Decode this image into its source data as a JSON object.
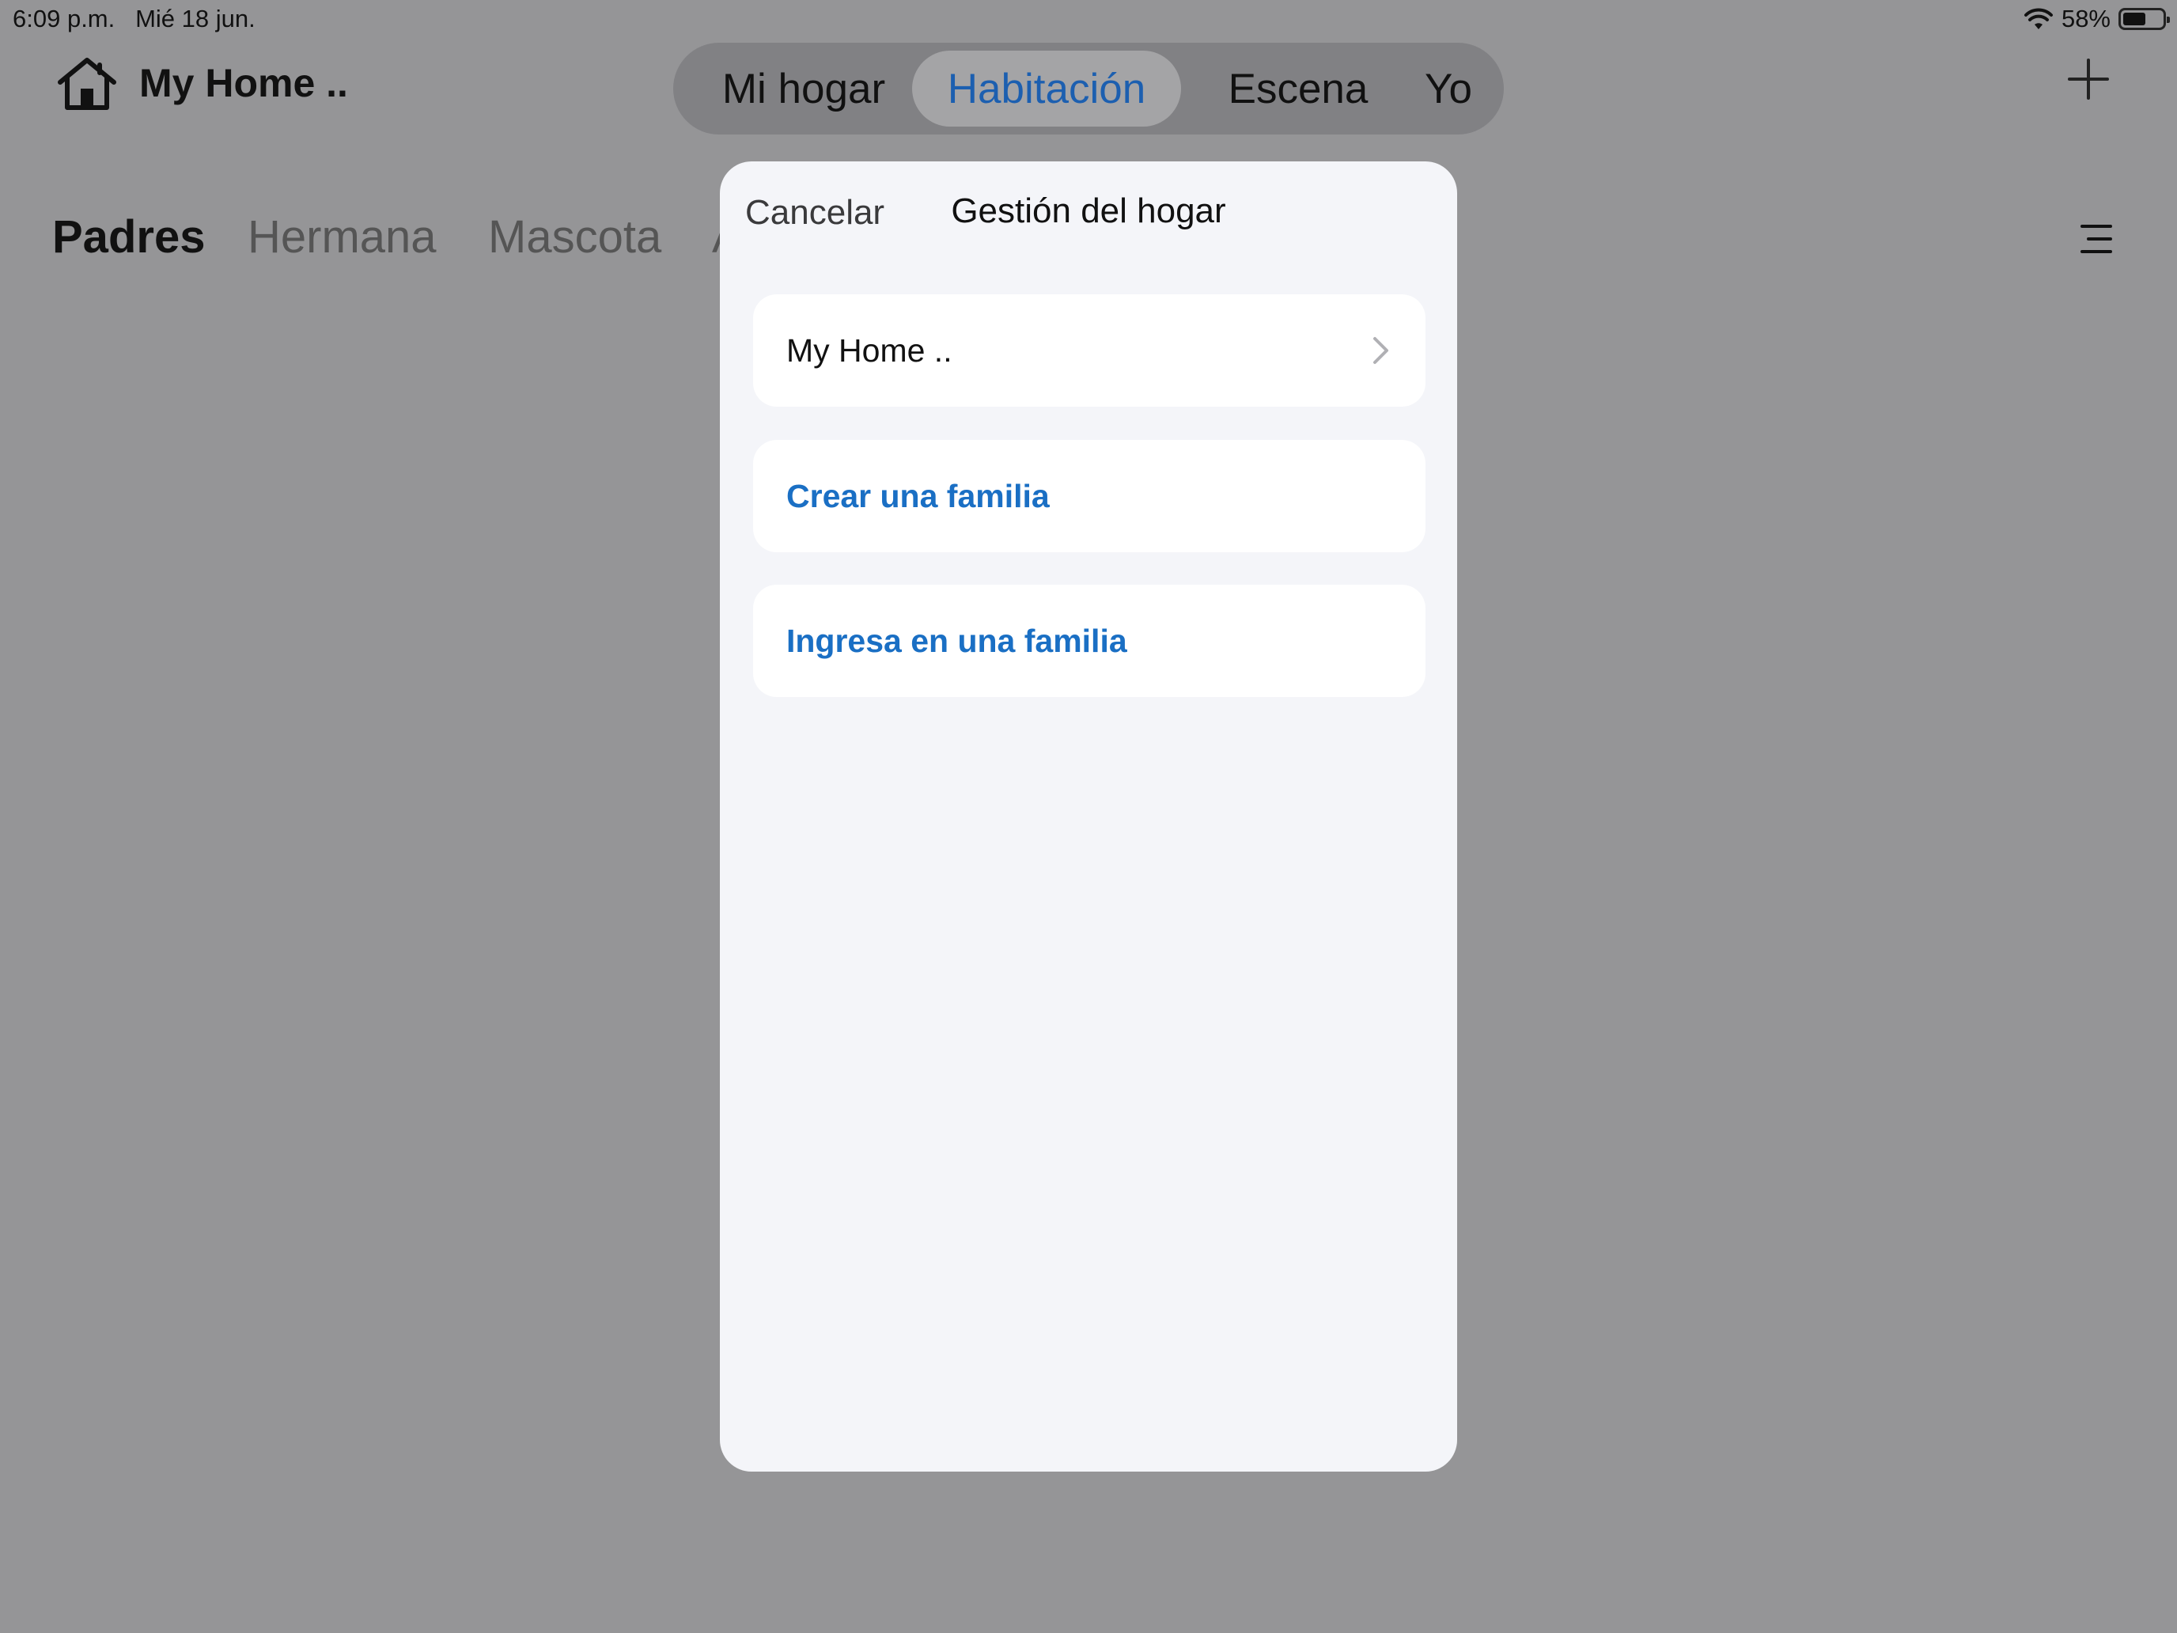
{
  "status_bar": {
    "time": "6:09 p.m.",
    "date": "Mié 18 jun.",
    "battery_percent": "58%",
    "battery_level": 0.58
  },
  "header": {
    "home_name": "My Home ..",
    "tabs": [
      {
        "label": "Mi hogar",
        "active": false
      },
      {
        "label": "Habitación",
        "active": true
      },
      {
        "label": "Escena",
        "active": false
      },
      {
        "label": "Yo",
        "active": false
      }
    ],
    "add_icon": "plus-icon"
  },
  "rooms": {
    "tabs": [
      {
        "label": "Padres",
        "active": true
      },
      {
        "label": "Hermana",
        "active": false
      },
      {
        "label": "Mascota",
        "active": false
      },
      {
        "label": "A",
        "active": false
      }
    ],
    "menu_icon": "list-menu-icon"
  },
  "modal": {
    "cancel_label": "Cancelar",
    "title": "Gestión del hogar",
    "home_item": "My Home ..",
    "create_family": "Crear una familia",
    "join_family": "Ingresa en una familia"
  },
  "colors": {
    "overlay_background": "#959597",
    "active_tab": "#1c5fb0",
    "link": "#1a6fc4",
    "modal_background": "#f4f5f9"
  }
}
